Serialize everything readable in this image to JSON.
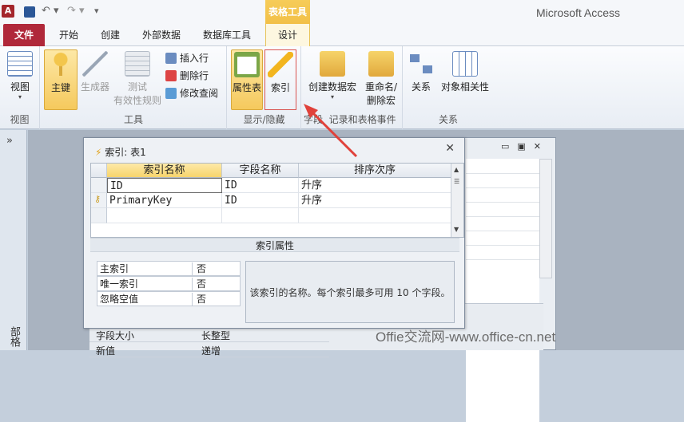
{
  "app": {
    "logo_letter": "A",
    "title": "Microsoft Access",
    "context_band": "表格工具"
  },
  "tabs": [
    "文件",
    "开始",
    "创建",
    "外部数据",
    "数据库工具",
    "设计"
  ],
  "ribbon": {
    "groups": {
      "view": {
        "label": "视图",
        "buttons": [
          "视图"
        ]
      },
      "tools": {
        "label": "工具",
        "buttons": [
          "主键",
          "生成器",
          "测试",
          "有效性规则",
          "插入行",
          "删除行",
          "修改查阅"
        ]
      },
      "show_hide": {
        "label": "显示/隐藏",
        "buttons": [
          "属性表",
          "索引"
        ]
      },
      "field": {
        "label": "字段"
      },
      "events": {
        "label": "记录和表格事件",
        "buttons": [
          "创建数据宏",
          "重命名/",
          "删除宏"
        ]
      },
      "relations": {
        "label": "关系",
        "buttons": [
          "关系",
          "对象相关性"
        ]
      }
    }
  },
  "nav": {
    "toggle": "»",
    "label": "部格"
  },
  "dialog": {
    "title": "索引: 表1",
    "columns": [
      "索引名称",
      "字段名称",
      "排序次序"
    ],
    "rows": [
      {
        "name": "ID",
        "field": "ID",
        "order": "升序"
      },
      {
        "name": "PrimaryKey",
        "field": "ID",
        "order": "升序"
      }
    ],
    "props_caption": "索引属性",
    "properties": [
      {
        "name": "主索引",
        "value": "否"
      },
      {
        "name": "唯一索引",
        "value": "否"
      },
      {
        "name": "忽略空值",
        "value": "否"
      }
    ],
    "description": "该索引的名称。每个索引最多可用 10 个字段。"
  },
  "lower_panel": [
    {
      "name": "字段大小",
      "value": "长整型"
    },
    {
      "name": "新值",
      "value": "递增"
    }
  ],
  "watermark": "Offie交流网-www.office-cn.net"
}
